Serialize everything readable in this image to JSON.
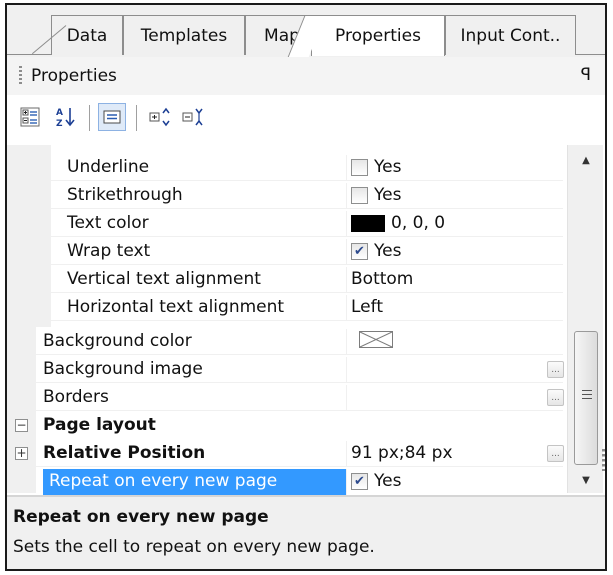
{
  "tabs": [
    {
      "label": "Data",
      "active": false
    },
    {
      "label": "Templates",
      "active": false
    },
    {
      "label": "Map",
      "active": false
    },
    {
      "label": "Properties",
      "active": true
    },
    {
      "label": "Input Cont..",
      "active": false
    }
  ],
  "panel": {
    "title": "Properties",
    "pin_glyph": "ꟼ"
  },
  "toolbar": {
    "buttons": [
      {
        "icon": "categorized-view-icon",
        "pressed": false
      },
      {
        "icon": "alphabetical-sort-icon",
        "pressed": false
      },
      {
        "icon": "property-pages-icon",
        "pressed": true
      },
      {
        "icon": "expand-all-icon",
        "pressed": false
      },
      {
        "icon": "collapse-all-icon",
        "pressed": false
      }
    ]
  },
  "grid": {
    "rows": [
      {
        "name": "Underline",
        "value": "Yes",
        "type": "checkbox",
        "checked": false
      },
      {
        "name": "Strikethrough",
        "value": "Yes",
        "type": "checkbox",
        "checked": false
      },
      {
        "name": "Text color",
        "value": "0, 0, 0",
        "type": "color",
        "color": "#000000"
      },
      {
        "name": "Wrap text",
        "value": "Yes",
        "type": "checkbox",
        "checked": true
      },
      {
        "name": "Vertical text alignment",
        "value": "Bottom",
        "type": "text"
      },
      {
        "name": "Horizontal text alignment",
        "value": "Left",
        "type": "text"
      },
      {
        "name": "Background color",
        "value": "",
        "type": "empty-color"
      },
      {
        "name": "Background image",
        "value": "",
        "type": "ellipsis"
      },
      {
        "name": "Borders",
        "value": "",
        "type": "ellipsis"
      },
      {
        "name": "Page layout",
        "value": "",
        "type": "category",
        "expander": "−"
      },
      {
        "name": "Relative Position",
        "value": "91 px;84 px",
        "type": "ellipsis-bold",
        "expander": "+"
      },
      {
        "name": "Repeat on every new page",
        "value": "Yes",
        "type": "checkbox",
        "checked": true,
        "selected": true
      }
    ],
    "ellipsis_label": "..."
  },
  "scrollbar": {
    "up_glyph": "▲",
    "down_glyph": "▼"
  },
  "description": {
    "title": "Repeat on every new page",
    "text": "Sets the cell to repeat on every new page."
  },
  "colors": {
    "selection": "#3399ff",
    "gutter": "#f0f0f0"
  }
}
